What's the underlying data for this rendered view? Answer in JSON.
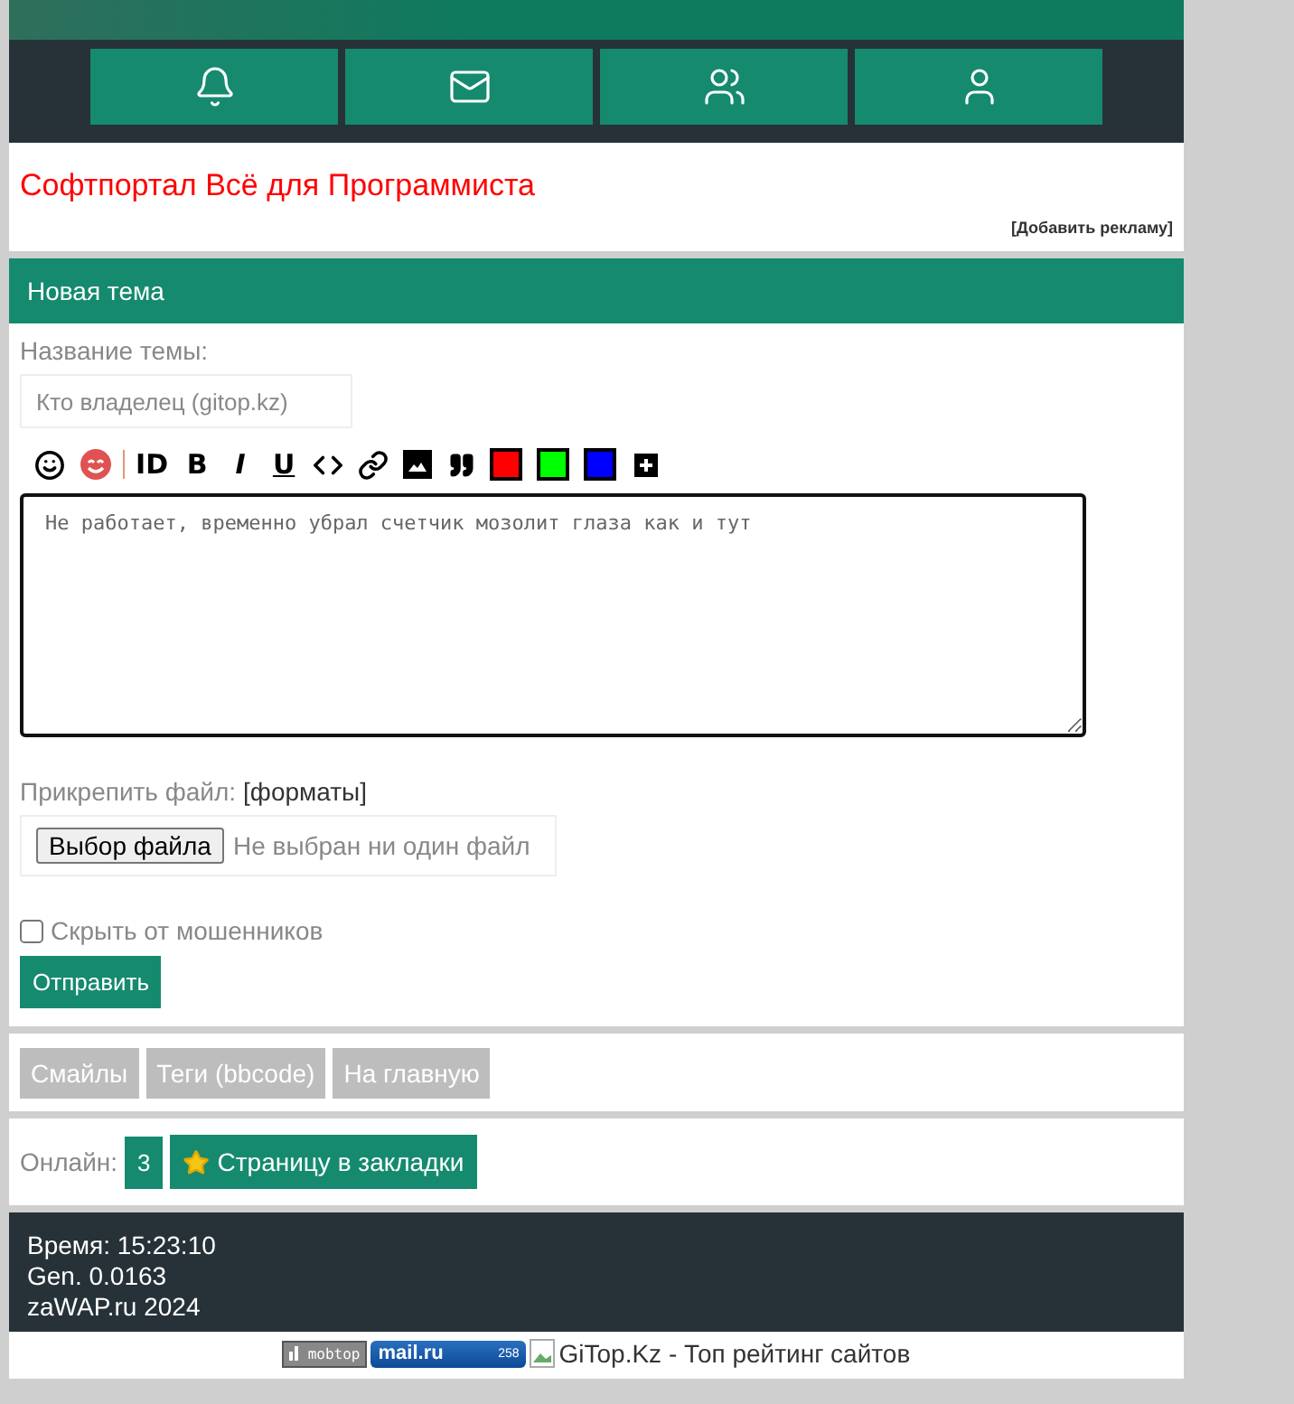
{
  "nav": {
    "items": [
      {
        "kind": "bell"
      },
      {
        "kind": "mail"
      },
      {
        "kind": "users"
      },
      {
        "kind": "user"
      }
    ]
  },
  "ad": {
    "title": "Софтпортал Всё для Программиста",
    "link": "[Добавить рекламу]"
  },
  "form": {
    "heading": "Новая тема",
    "topic_label": "Название темы:",
    "topic_placeholder": "Кто владелец (gitop.kz)",
    "toolbar": [
      {
        "kind": "smile"
      },
      {
        "kind": "love"
      },
      {
        "kind": "divider"
      },
      {
        "kind": "bold",
        "label": "ID"
      },
      {
        "kind": "bold",
        "label": "B"
      },
      {
        "kind": "italic",
        "label": "I"
      },
      {
        "kind": "underline",
        "label": "U"
      },
      {
        "kind": "code"
      },
      {
        "kind": "link"
      },
      {
        "kind": "image"
      },
      {
        "kind": "quote"
      },
      {
        "kind": "color",
        "color": "#ff0000"
      },
      {
        "kind": "color",
        "color": "#00ff00"
      },
      {
        "kind": "color",
        "color": "#0000ff"
      },
      {
        "kind": "plus"
      }
    ],
    "message": "Не работает, временно убрал счетчик мозолит глаза как и тут",
    "attach_label": "Прикрепить файл:",
    "formats_link": "[форматы]",
    "file_button": "Выбор файла",
    "file_status": "Не выбран ни один файл",
    "hide_label": "Скрыть от мошенников",
    "hide_checked": false,
    "submit": "Отправить"
  },
  "links": [
    "Смайлы",
    "Теги (bbcode)",
    "На главную"
  ],
  "online": {
    "label": "Онлайн:",
    "count": "3",
    "bookmark": "Страницу в закладки"
  },
  "footer": [
    "Время: 15:23:10",
    "Gen. 0.0163",
    "zaWAP.ru 2024"
  ],
  "counters": {
    "mobtop": "mobtop",
    "mailru": "mail.ru",
    "mailru_count": "258",
    "gitop_alt": "GiTop.Kz - Топ рейтинг сайтов"
  }
}
